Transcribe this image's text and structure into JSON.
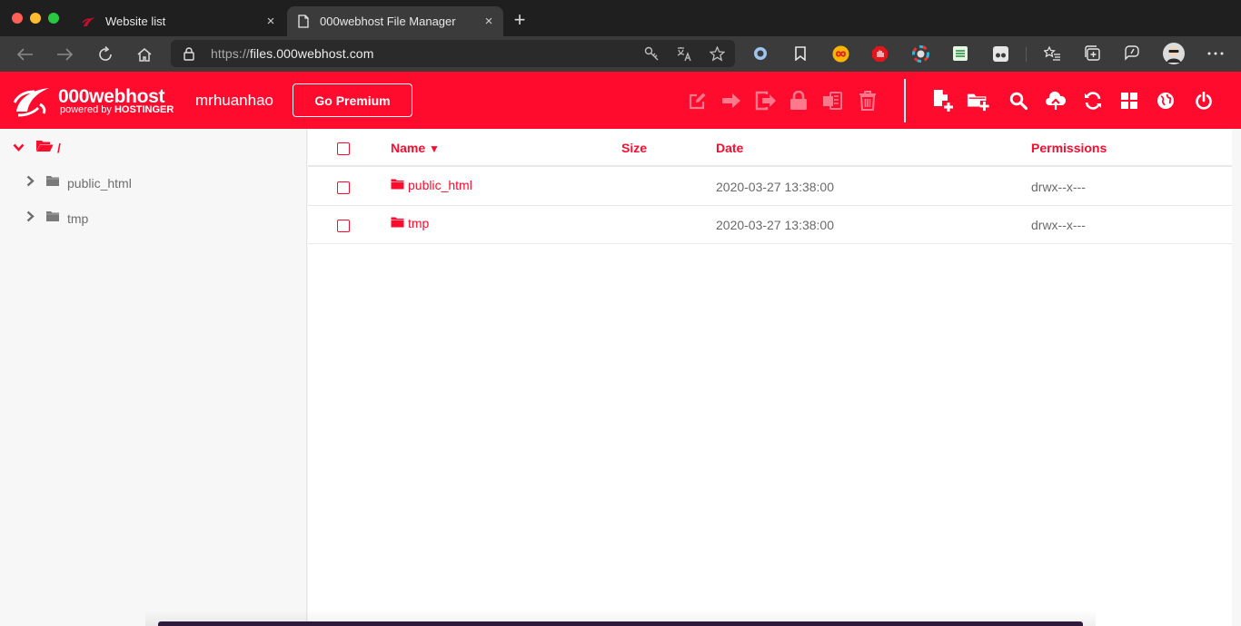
{
  "browser": {
    "tabs": [
      {
        "title": "Website list",
        "active": false
      },
      {
        "title": "000webhost File Manager",
        "active": true
      }
    ],
    "new_tab": "+",
    "close_glyph": "×",
    "url_prefix": "https://",
    "url_host": "files.000webhost.com"
  },
  "header": {
    "brand": "000webhost",
    "brand_sub_prefix": "powered by ",
    "brand_sub_name": "HOSTINGER",
    "username": "mrhuanhao",
    "premium_label": "Go Premium",
    "accent": "#ff0b2e"
  },
  "sidebar": {
    "root_label": "/",
    "items": [
      {
        "label": "public_html"
      },
      {
        "label": "tmp"
      }
    ]
  },
  "table": {
    "columns": {
      "name": "Name",
      "sort_indicator": "▼",
      "size": "Size",
      "date": "Date",
      "permissions": "Permissions"
    },
    "rows": [
      {
        "name": "public_html",
        "size": "",
        "date": "2020-03-27 13:38:00",
        "permissions": "drwx--x---"
      },
      {
        "name": "tmp",
        "size": "",
        "date": "2020-03-27 13:38:00",
        "permissions": "drwx--x---"
      }
    ]
  }
}
